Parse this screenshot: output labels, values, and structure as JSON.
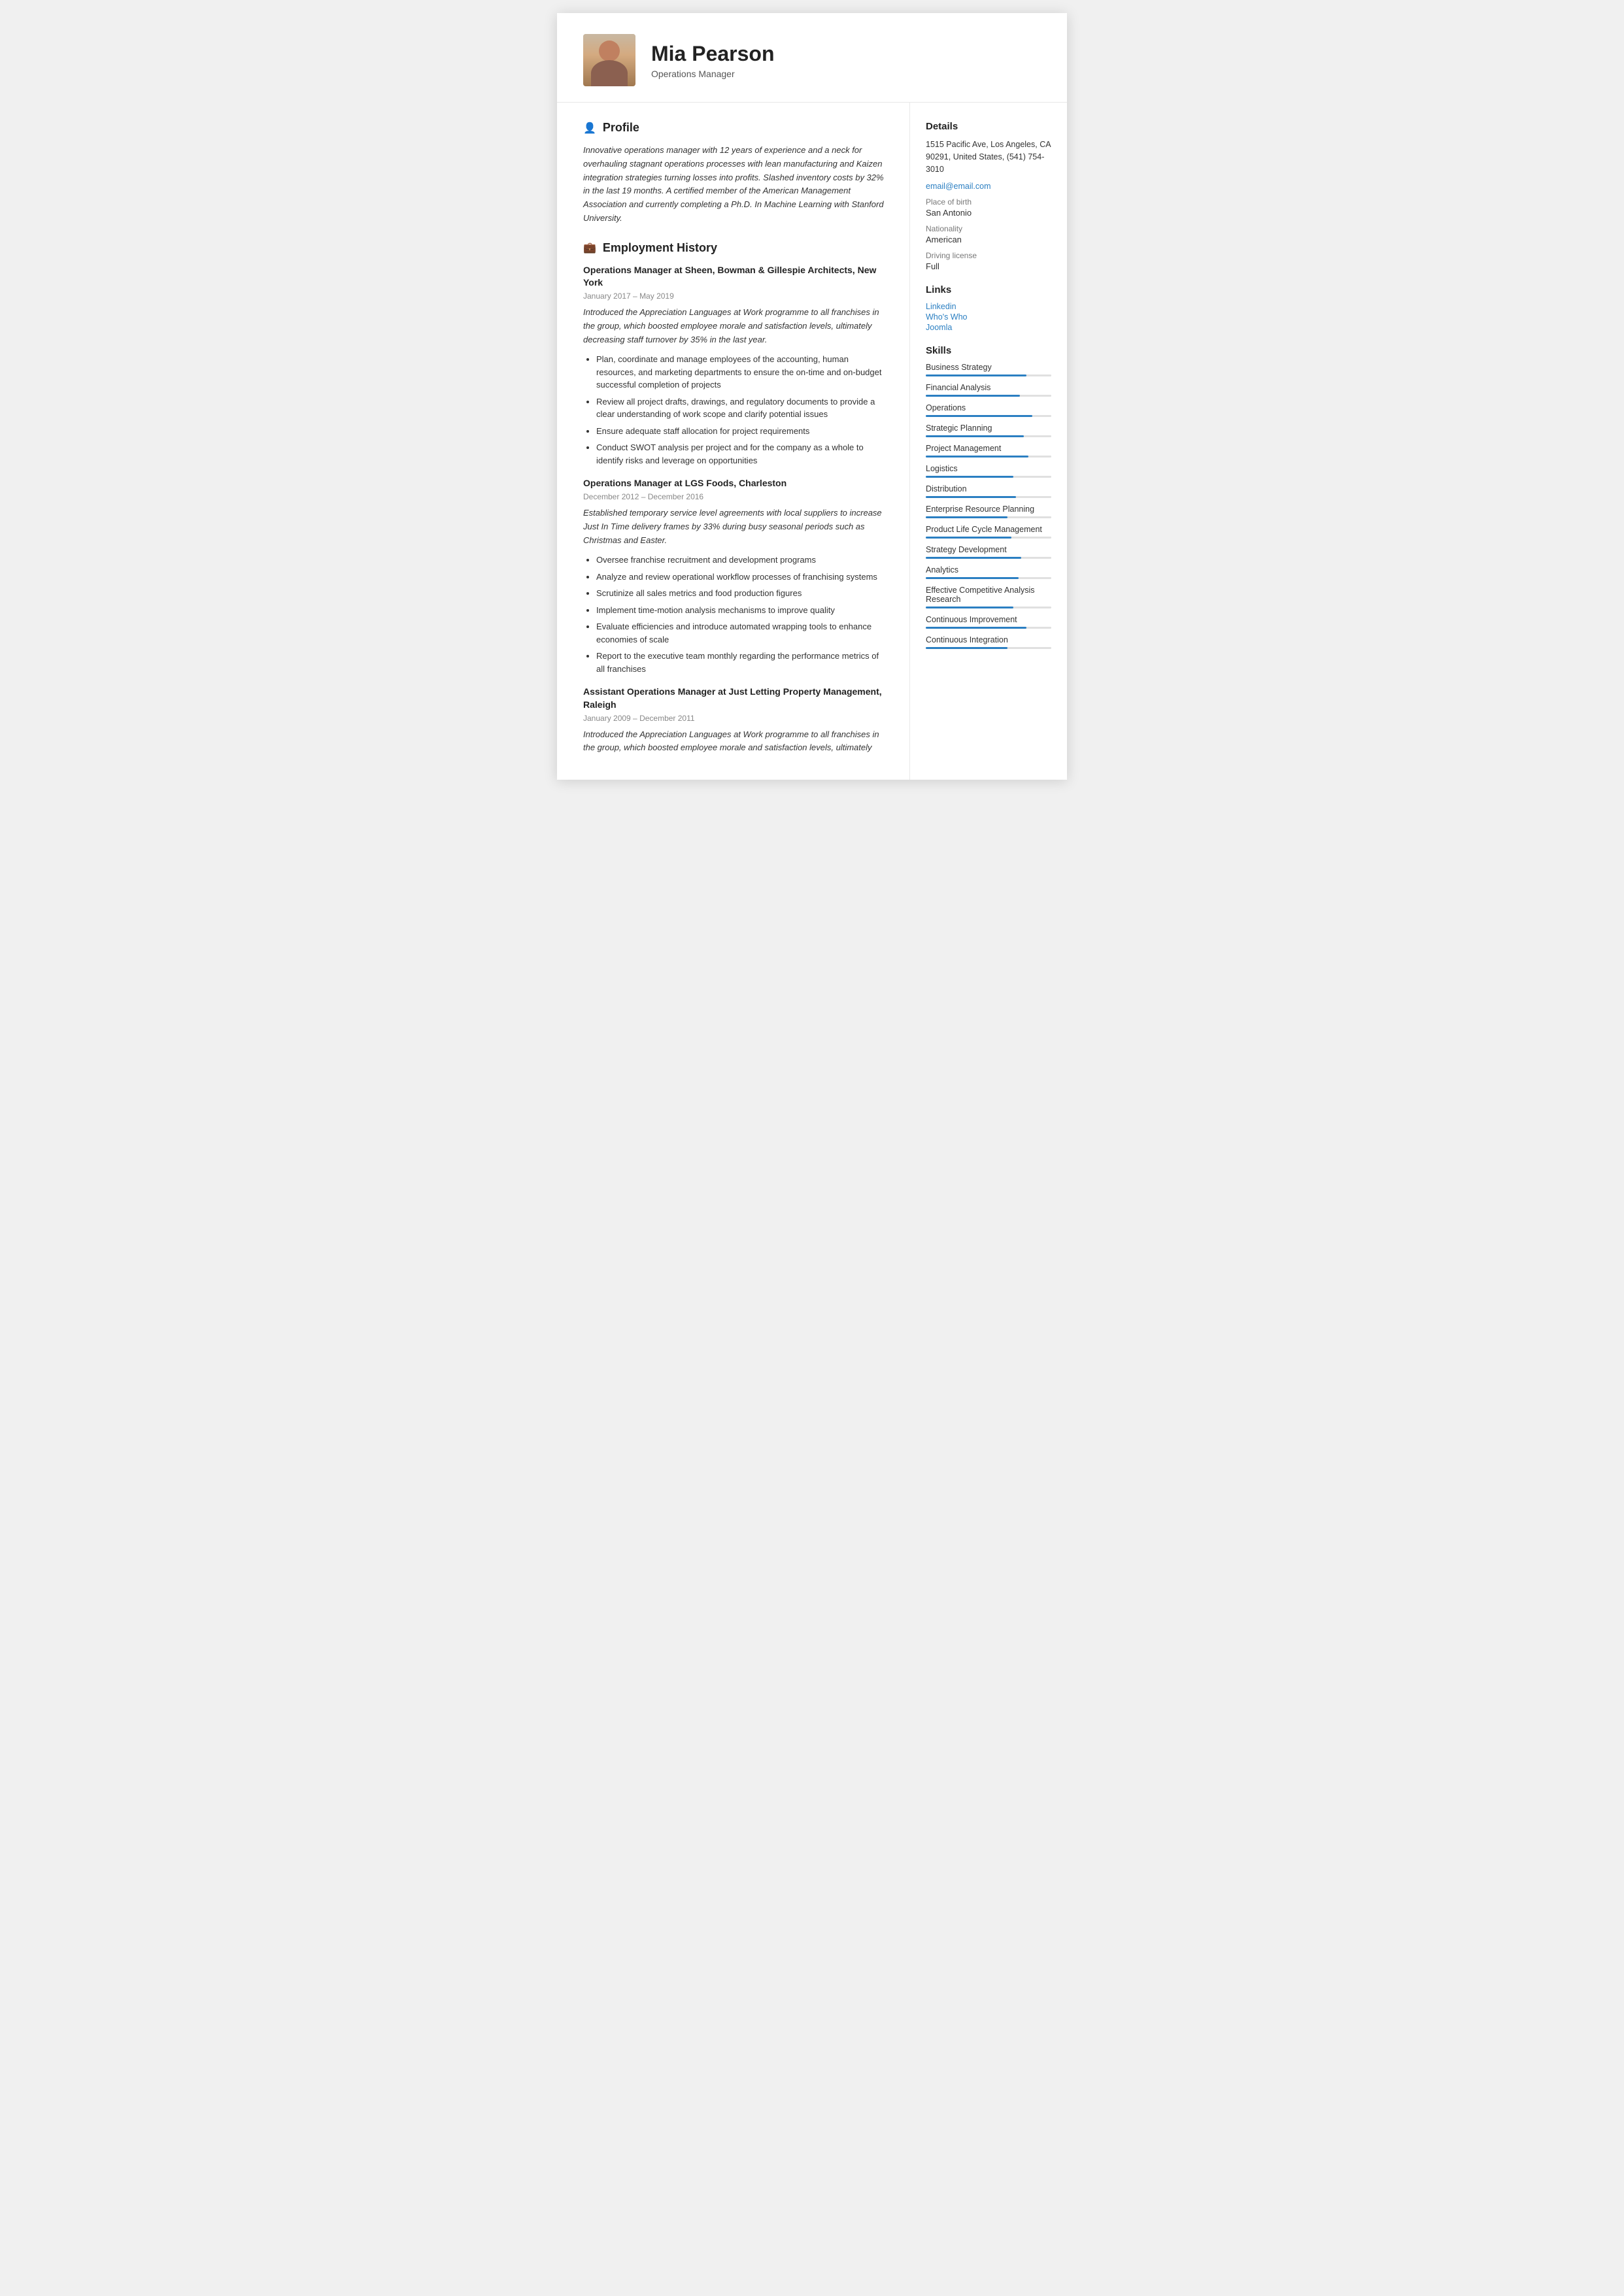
{
  "header": {
    "name": "Mia Pearson",
    "job_title": "Operations Manager"
  },
  "profile": {
    "section_label": "Profile",
    "text": "Innovative operations manager with 12 years of experience and a neck for overhauling stagnant operations processes with lean manufacturing and Kaizen integration strategies turning losses into profits. Slashed inventory costs by 32% in the last 19 months. A certified member of the American Management Association and currently completing a Ph.D. In Machine Learning with Stanford University."
  },
  "employment": {
    "section_label": "Employment History",
    "jobs": [
      {
        "title": "Operations Manager at Sheen, Bowman & Gillespie Architects, New York",
        "dates": "January 2017 – May 2019",
        "description": "Introduced the Appreciation Languages at Work programme to all franchises in the group, which boosted employee morale and satisfaction levels, ultimately decreasing staff turnover by 35% in the last year.",
        "bullets": [
          "Plan, coordinate and manage employees of the accounting, human resources, and marketing departments to ensure the on-time and on-budget successful completion of projects",
          "Review all project drafts, drawings, and regulatory documents to provide a clear understanding of work scope and clarify potential issues",
          "Ensure adequate staff allocation for project requirements",
          "Conduct SWOT analysis per project and for the company as a whole to identify risks and leverage on opportunities"
        ]
      },
      {
        "title": "Operations Manager at LGS Foods, Charleston",
        "dates": "December 2012 – December 2016",
        "description": "Established temporary service level agreements with local suppliers to increase Just In Time delivery frames by 33% during busy seasonal periods such as Christmas and Easter.",
        "bullets": [
          "Oversee franchise recruitment and development programs",
          "Analyze and review operational workflow processes of franchising systems",
          "Scrutinize all sales metrics and food production figures",
          "Implement time-motion analysis mechanisms to improve quality",
          "Evaluate efficiencies and introduce automated wrapping tools to enhance economies of scale",
          "Report to the executive team monthly regarding the performance metrics of all franchises"
        ]
      },
      {
        "title": "Assistant Operations Manager at Just Letting Property Management, Raleigh",
        "dates": "January 2009 – December 2011",
        "description": "Introduced the Appreciation Languages at Work programme to all franchises in the group, which boosted employee morale and satisfaction levels, ultimately",
        "bullets": []
      }
    ]
  },
  "details": {
    "section_label": "Details",
    "address": "1515 Pacific Ave, Los Angeles, CA 90291, United States, (541) 754-3010",
    "email": "email@email.com",
    "place_of_birth_label": "Place of birth",
    "place_of_birth": "San Antonio",
    "nationality_label": "Nationality",
    "nationality": "American",
    "driving_license_label": "Driving license",
    "driving_license": "Full"
  },
  "links": {
    "section_label": "Links",
    "items": [
      {
        "label": "Linkedin",
        "url": "#"
      },
      {
        "label": "Who's Who",
        "url": "#"
      },
      {
        "label": "Joomla",
        "url": "#"
      }
    ]
  },
  "skills": {
    "section_label": "Skills",
    "items": [
      {
        "name": "Business Strategy",
        "pct": 80
      },
      {
        "name": "Financial Analysis",
        "pct": 75
      },
      {
        "name": "Operations",
        "pct": 85
      },
      {
        "name": "Strategic Planning",
        "pct": 78
      },
      {
        "name": "Project Management",
        "pct": 82
      },
      {
        "name": "Logistics",
        "pct": 70
      },
      {
        "name": "Distribution",
        "pct": 72
      },
      {
        "name": "Enterprise Resource Planning",
        "pct": 65
      },
      {
        "name": "Product Life Cycle Management",
        "pct": 68
      },
      {
        "name": "Strategy Development",
        "pct": 76
      },
      {
        "name": "Analytics",
        "pct": 74
      },
      {
        "name": "Effective Competitive Analysis Research",
        "pct": 70
      },
      {
        "name": "Continuous Improvement",
        "pct": 80
      },
      {
        "name": "Continuous Integration",
        "pct": 65
      }
    ]
  }
}
